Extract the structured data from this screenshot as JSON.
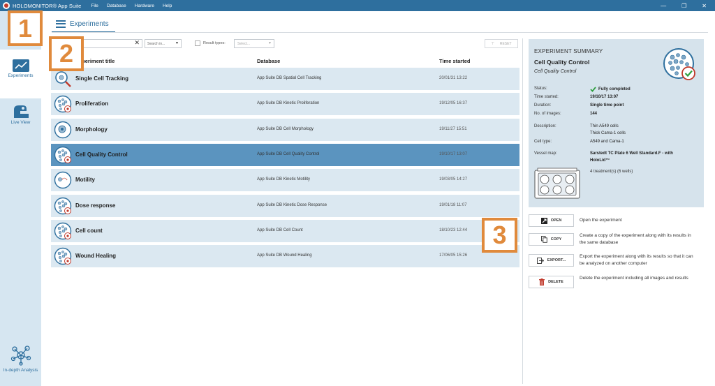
{
  "titlebar": {
    "app_title": "HOLOMONITOR® App Suite",
    "menu": [
      "File",
      "Database",
      "Hardware",
      "Help"
    ]
  },
  "nav": {
    "experiments": "Experiments",
    "live_view": "Live View",
    "analysis": "In-depth Analysis"
  },
  "header": {
    "title": "Experiments"
  },
  "filters": {
    "search_in": "Search in...",
    "result_types_label": "Result types:",
    "select_placeholder": "Select...",
    "reset_label": "RESET"
  },
  "table": {
    "columns": [
      "Experiment title",
      "Database",
      "Time started"
    ],
    "rows": [
      {
        "title": "Single Cell Tracking",
        "database": "App Suite DB Spatial Cell Tracking",
        "time": "20/01/31 13:22",
        "icon": "magnifier-cell-icon"
      },
      {
        "title": "Proliferation",
        "database": "App Suite DB Kinetic Proliferation",
        "time": "19/12/05 16:37",
        "icon": "proliferation-icon"
      },
      {
        "title": "Morphology",
        "database": "App Suite DB Cell Morphology",
        "time": "19/11/27 15:51",
        "icon": "morphology-icon"
      },
      {
        "title": "Cell Quality Control",
        "database": "App Suite DB Cell Quality Control",
        "time": "19/10/17 13:07",
        "icon": "quality-control-icon"
      },
      {
        "title": "Motility",
        "database": "App Suite DB Kinetic Motility",
        "time": "19/03/05 14:27",
        "icon": "motility-icon"
      },
      {
        "title": "Dose response",
        "database": "App Suite DB Kinetic Dose Response",
        "time": "19/01/18 11:07",
        "icon": "dose-response-icon"
      },
      {
        "title": "Cell count",
        "database": "App Suite DB Cell Count",
        "time": "18/10/23 12:44",
        "icon": "cell-count-icon"
      },
      {
        "title": "Wound Healing",
        "database": "App Suite DB Wound Healing",
        "time": "17/06/05 15:26",
        "icon": "wound-healing-icon"
      }
    ],
    "selected_index": 3
  },
  "summary": {
    "heading": "EXPERIMENT SUMMARY",
    "title": "Cell Quality Control",
    "subtitle": "Cell Quality Control",
    "status_label": "Status:",
    "status_value": "Fully completed",
    "time_label": "Time started:",
    "time_value": "19/10/17 13:07",
    "duration_label": "Duration:",
    "duration_value": "Single time point",
    "images_label": "No. of images:",
    "images_value": "144",
    "description_label": "Description:",
    "description_line1": "Thin A549 cells",
    "description_line2": "Thick Cama-1 cells",
    "celltype_label": "Cell type:",
    "celltype_value": "A549 and Cama-1",
    "vessel_label": "Vessel map:",
    "vessel_line1": "Sarstedt TC Plate 6 Well Standard.F - with",
    "vessel_line2": "HoloLid™",
    "treatments": "4 treatment(s) (6 wells)"
  },
  "actions": [
    {
      "label": "OPEN",
      "desc": "Open the experiment",
      "icon": "open-icon"
    },
    {
      "label": "COPY",
      "desc": "Create a copy of the experiment along with its results in the same database",
      "icon": "copy-icon"
    },
    {
      "label": "EXPORT...",
      "desc": "Export the experiment along with its results so that it can be analyzed on another computer",
      "icon": "export-icon"
    },
    {
      "label": "DELETE",
      "desc": "Delete the experiment including all images and results",
      "icon": "trash-icon"
    }
  ],
  "callouts": [
    "1",
    "2",
    "3"
  ],
  "colors": {
    "accent": "#2e6f9e",
    "row": "#dbe8f1",
    "row_selected": "#5b94bf",
    "callout": "#e08a3c",
    "success": "#2e9e3e",
    "delete": "#c0392b"
  }
}
